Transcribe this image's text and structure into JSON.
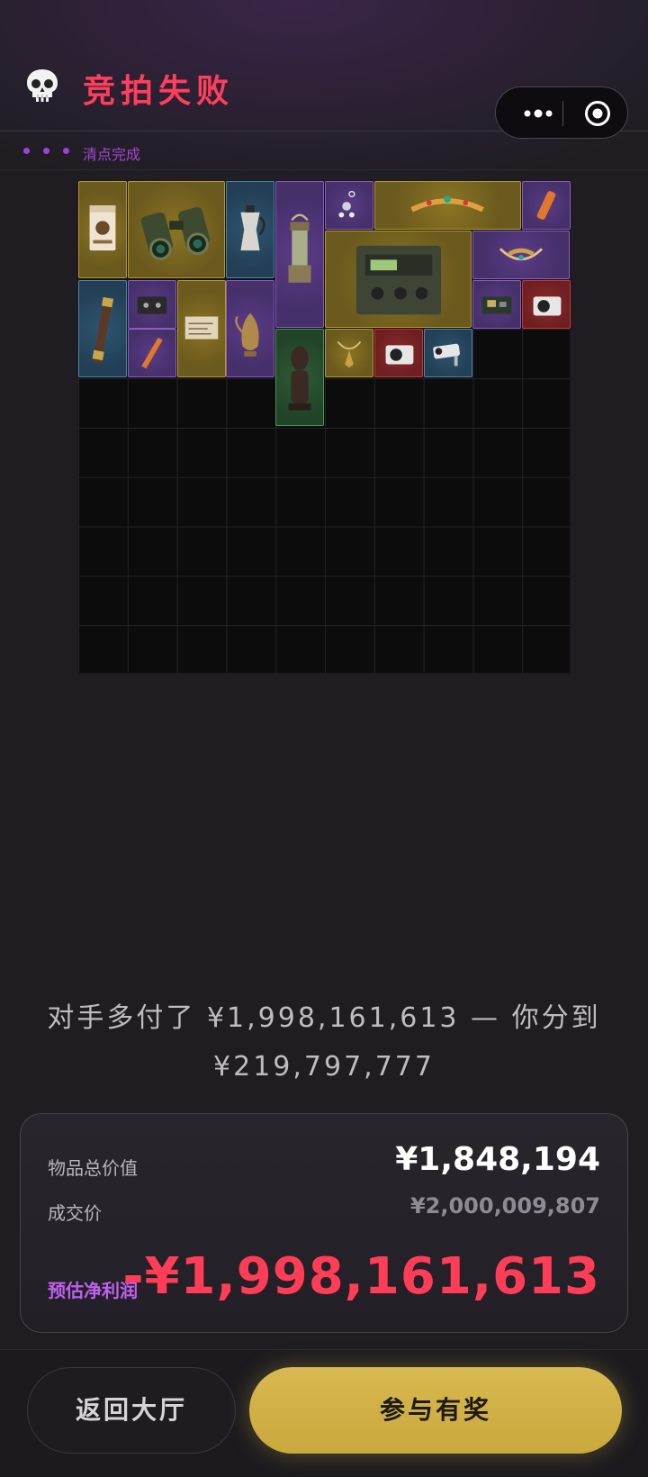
{
  "header": {
    "title": "竞拍失败",
    "progress_text": "清点完成",
    "skull_icon": "skull-icon",
    "capsule": {
      "more_icon": "more-dots-icon",
      "close_icon": "target-circle-icon"
    }
  },
  "inventory": {
    "columns": 10,
    "rows": 10,
    "items": [
      {
        "name": "coffee-bag",
        "rarity": "gold",
        "icon": "coffee-bag-icon"
      },
      {
        "name": "binoculars",
        "rarity": "gold",
        "icon": "binoculars-icon"
      },
      {
        "name": "moka-pot",
        "rarity": "blue",
        "icon": "moka-pot-icon"
      },
      {
        "name": "lantern",
        "rarity": "purple",
        "icon": "lantern-icon"
      },
      {
        "name": "earring",
        "rarity": "purple",
        "icon": "earring-icon"
      },
      {
        "name": "tiara",
        "rarity": "gold",
        "icon": "tiara-icon"
      },
      {
        "name": "orange-tube",
        "rarity": "purple",
        "icon": "tube-icon"
      },
      {
        "name": "military-radio",
        "rarity": "gold",
        "icon": "radio-icon"
      },
      {
        "name": "horned-necklace",
        "rarity": "purple",
        "icon": "necklace-icon"
      },
      {
        "name": "spyglass",
        "rarity": "blue",
        "icon": "spyglass-icon"
      },
      {
        "name": "cassette-tape",
        "rarity": "purple",
        "icon": "cassette-icon"
      },
      {
        "name": "old-map-paper",
        "rarity": "gold",
        "icon": "paper-icon"
      },
      {
        "name": "hookah-ewer",
        "rarity": "purple",
        "icon": "ewer-icon"
      },
      {
        "name": "circuit-board",
        "rarity": "purple",
        "icon": "circuit-board-icon"
      },
      {
        "name": "camera-red",
        "rarity": "red",
        "icon": "camera-icon"
      },
      {
        "name": "marker-pen",
        "rarity": "purple",
        "icon": "pen-icon"
      },
      {
        "name": "tribal-statue",
        "rarity": "green",
        "icon": "statue-icon"
      },
      {
        "name": "pendant",
        "rarity": "gold",
        "icon": "pendant-icon"
      },
      {
        "name": "camera-red-2",
        "rarity": "red",
        "icon": "camera-icon"
      },
      {
        "name": "cctv-camera",
        "rarity": "blue",
        "icon": "cctv-icon"
      }
    ]
  },
  "message": {
    "line1": "对手多付了 ¥1,998,161,613 — 你分到",
    "line2": "¥219,797,777"
  },
  "summary": {
    "total_label": "物品总价值",
    "total_value": "¥1,848,194",
    "deal_label": "成交价",
    "deal_value": "¥2,000,009,807",
    "profit_label": "预估净利润",
    "profit_value": "-¥1,998,161,613"
  },
  "buttons": {
    "back_label": "返回大厅",
    "join_label": "参与有奖"
  },
  "colors": {
    "accent_red": "#ff3e5c",
    "accent_purple": "#a347d6",
    "gold": "#d4b446"
  }
}
